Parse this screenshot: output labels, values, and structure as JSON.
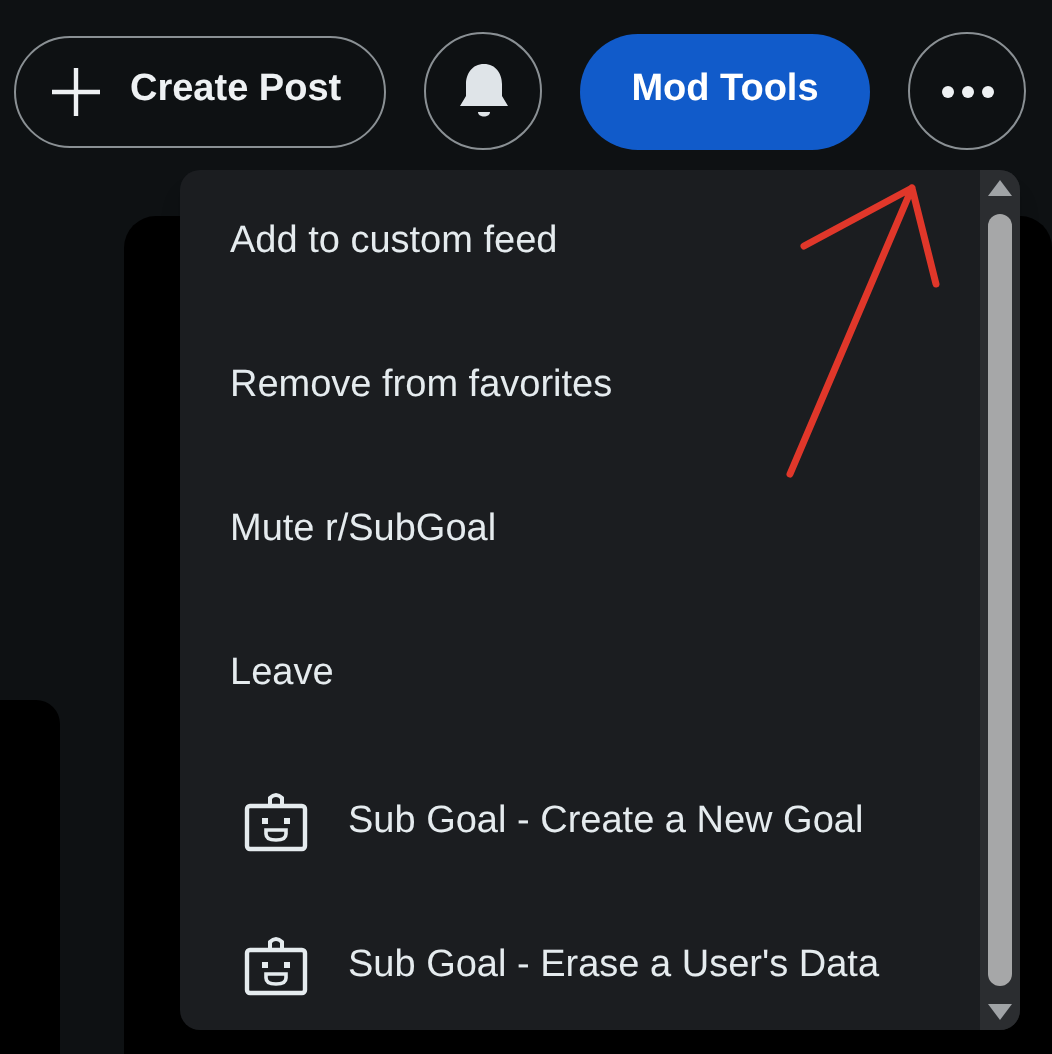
{
  "header": {
    "create_post": "Create Post",
    "mod_tools": "Mod Tools"
  },
  "menu": {
    "items": [
      {
        "kind": "action",
        "label": "Add to custom feed"
      },
      {
        "kind": "action",
        "label": "Remove from favorites"
      },
      {
        "kind": "action",
        "label": "Mute r/SubGoal"
      },
      {
        "kind": "action",
        "label": "Leave"
      },
      {
        "kind": "app",
        "label": "Sub Goal - Create a New Goal"
      },
      {
        "kind": "app",
        "label": "Sub Goal - Erase a User's Data"
      }
    ]
  }
}
